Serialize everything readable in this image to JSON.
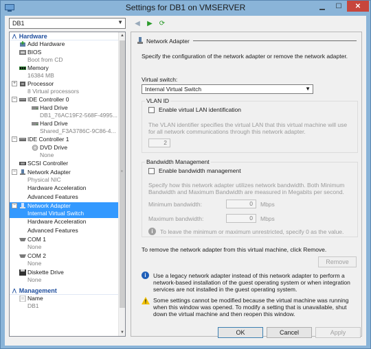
{
  "window": {
    "title": "Settings for DB1 on VMSERVER"
  },
  "vm_selector": {
    "value": "DB1"
  },
  "tree": {
    "hardware_header": "Hardware",
    "management_header": "Management",
    "items": [
      {
        "label": "Add Hardware",
        "sub": ""
      },
      {
        "label": "BIOS",
        "sub": "Boot from CD"
      },
      {
        "label": "Memory",
        "sub": "16384 MB"
      },
      {
        "label": "Processor",
        "sub": "8 Virtual processors"
      },
      {
        "label": "IDE Controller 0",
        "sub": ""
      },
      {
        "label": "Hard Drive",
        "sub": "DB1_76AC19F2-568F-4995..."
      },
      {
        "label": "Hard Drive",
        "sub": "Shared_F3A3786C-9C86-4..."
      },
      {
        "label": "IDE Controller 1",
        "sub": ""
      },
      {
        "label": "DVD Drive",
        "sub": "None"
      },
      {
        "label": "SCSI Controller",
        "sub": ""
      },
      {
        "label": "Network Adapter",
        "sub": "Physical NIC"
      },
      {
        "label": "Hardware Acceleration",
        "sub": ""
      },
      {
        "label": "Advanced Features",
        "sub": ""
      },
      {
        "label": "Network Adapter",
        "sub": "Internal Virtual Switch"
      },
      {
        "label": "Hardware Acceleration",
        "sub": ""
      },
      {
        "label": "Advanced Features",
        "sub": ""
      },
      {
        "label": "COM 1",
        "sub": "None"
      },
      {
        "label": "COM 2",
        "sub": "None"
      },
      {
        "label": "Diskette Drive",
        "sub": "None"
      },
      {
        "label": "Name",
        "sub": "DB1"
      }
    ]
  },
  "panel": {
    "title": "Network Adapter",
    "description": "Specify the configuration of the network adapter or remove the network adapter.",
    "switch_label": "Virtual switch:",
    "switch_value": "Internal Virtual Switch",
    "vlan": {
      "group_label": "VLAN ID",
      "checkbox_label": "Enable virtual LAN identification",
      "help": "The VLAN identifier specifies the virtual LAN that this virtual machine will use for all network communications through this network adapter.",
      "value": "2"
    },
    "bandwidth": {
      "group_label": "Bandwidth Management",
      "checkbox_label": "Enable bandwidth management",
      "help": "Specify how this network adapter utilizes network bandwidth. Both Minimum Bandwidth and Maximum Bandwidth are measured in Megabits per second.",
      "min_label": "Minimum bandwidth:",
      "min_value": "0",
      "max_label": "Maximum bandwidth:",
      "max_value": "0",
      "unit": "Mbps",
      "note": "To leave the minimum or maximum unrestricted, specify 0 as the value."
    },
    "remove_text": "To remove the network adapter from this virtual machine, click Remove.",
    "remove_button": "Remove",
    "info_text": "Use a legacy network adapter instead of this network adapter to perform a network-based installation of the guest operating system or when integration services are not installed in the guest operating system.",
    "warning_text": "Some settings cannot be modified because the virtual machine was running when this window was opened. To modify a setting that is unavailable, shut down the virtual machine and then reopen this window."
  },
  "buttons": {
    "ok": "OK",
    "cancel": "Cancel",
    "apply": "Apply"
  }
}
